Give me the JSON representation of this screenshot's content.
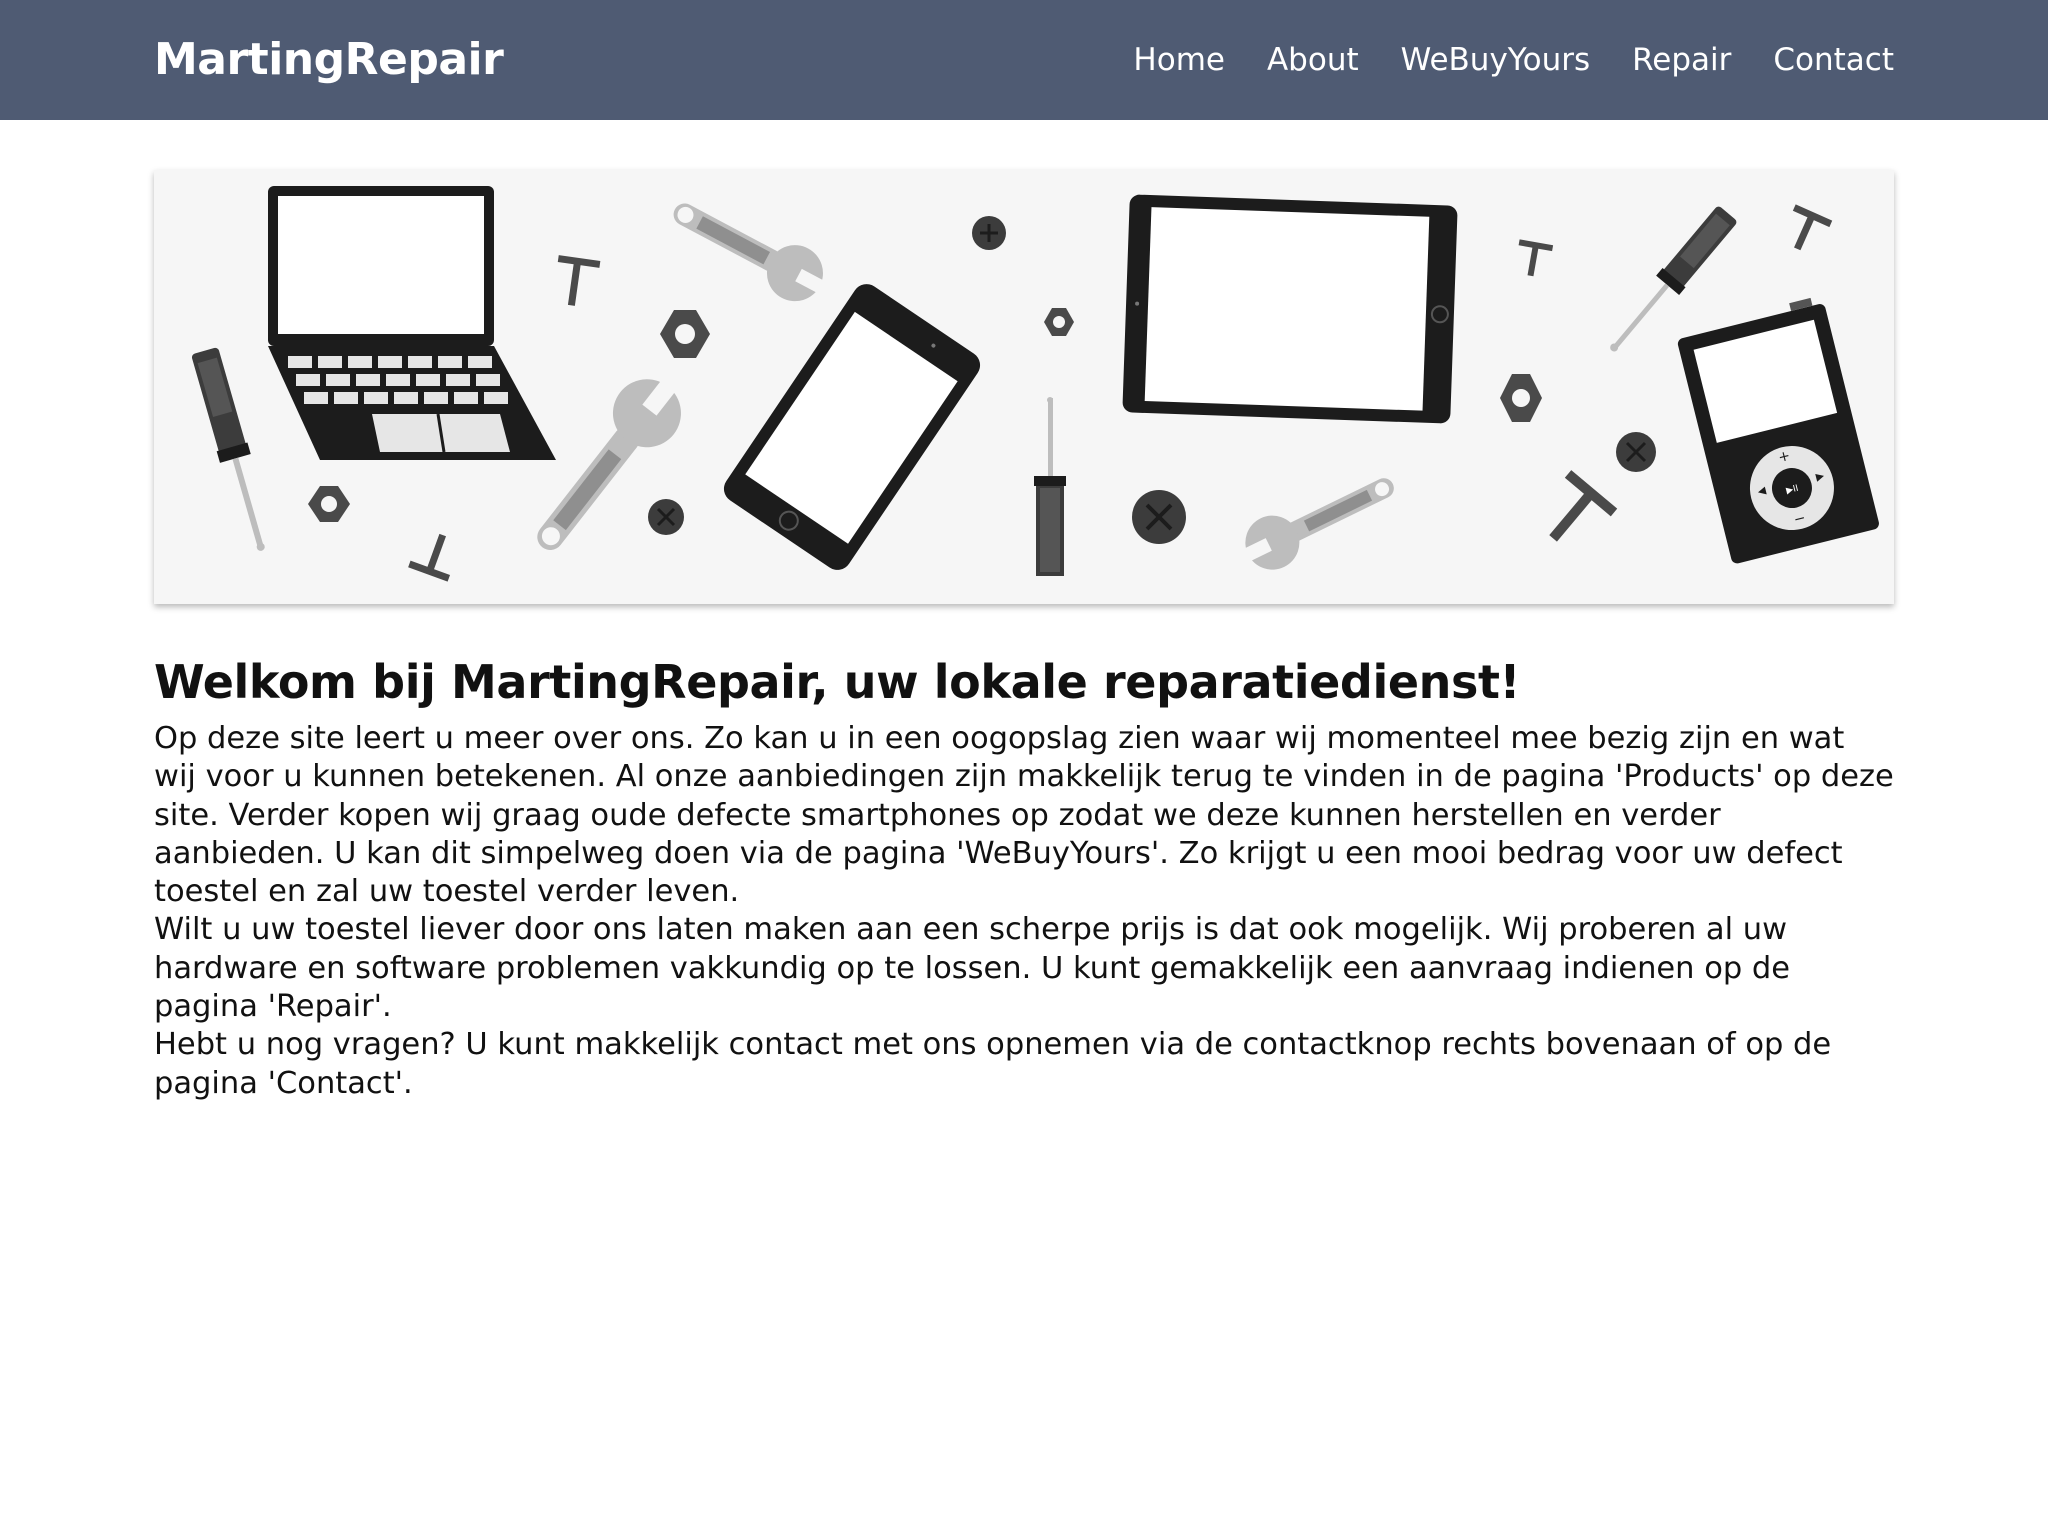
{
  "header": {
    "brand": "MartingRepair",
    "nav": [
      {
        "label": "Home"
      },
      {
        "label": "About"
      },
      {
        "label": "WeBuyYours"
      },
      {
        "label": "Repair"
      },
      {
        "label": "Contact"
      }
    ]
  },
  "hero": {
    "icons": [
      "laptop-icon",
      "screwdriver-icon",
      "wrench-icon",
      "hex-nut-icon",
      "screw-icon",
      "t-bolt-icon",
      "smartphone-icon",
      "tablet-icon",
      "music-player-icon"
    ],
    "player_button_plus": "+",
    "player_button_minus": "−",
    "player_play_pause": "▶II"
  },
  "main": {
    "title": "Welkom bij MartingRepair, uw lokale reparatiedienst!",
    "paragraphs": [
      "Op deze site leert u meer over ons. Zo kan u in een oogopslag zien waar wij momenteel mee bezig zijn en wat wij voor u kunnen betekenen. Al onze aanbiedingen zijn makkelijk terug te vinden in de pagina 'Products' op deze site. Verder kopen wij graag oude defecte smartphones op zodat we deze kunnen herstellen en verder aanbieden. U kan dit simpelweg doen via de pagina 'WeBuyYours'. Zo krijgt u een mooi bedrag voor uw defect toestel en zal uw toestel verder leven.",
      "Wilt u uw toestel liever door ons laten maken aan een scherpe prijs is dat ook mogelijk. Wij proberen al uw hardware en software problemen vakkundig op te lossen. U kunt gemakkelijk een aanvraag indienen op de pagina 'Repair'.",
      "Hebt u nog vragen? U kunt makkelijk contact met ons opnemen via de contactknop rechts bovenaan of op de pagina 'Contact'."
    ]
  },
  "colors": {
    "navbar": "#4f5b73",
    "device_dark": "#1c1c1c",
    "tool_light": "#bdbdbd",
    "tool_mid": "#8f8f8f",
    "tool_dark": "#3c3c3c"
  }
}
